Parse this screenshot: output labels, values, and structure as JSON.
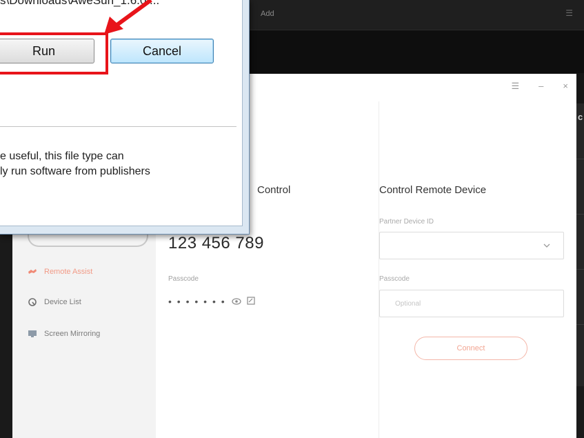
{
  "background_window": {
    "title": "Add",
    "menu_icon": "hamburger-icon",
    "right_edge_char": "c"
  },
  "app": {
    "titlebar": {
      "menu_glyph": "☰",
      "minimize_glyph": "–",
      "close_glyph": "×"
    },
    "sidebar": {
      "items": [
        {
          "label": "Remote Assist",
          "icon": "remote-assist-icon",
          "active": true,
          "color": "#f29a86"
        },
        {
          "label": "Device List",
          "icon": "device-list-icon",
          "active": false
        },
        {
          "label": "Screen Mirroring",
          "icon": "screen-mirroring-icon",
          "active": false
        }
      ]
    },
    "allow_panel": {
      "title": "Control",
      "device_id": "123 456 789",
      "passcode_label": "Passcode",
      "passcode_dots": "• • • • • • •"
    },
    "control_panel": {
      "title": "Control Remote Device",
      "partner_label": "Partner Device ID",
      "passcode_label": "Passcode",
      "passcode_placeholder": "Optional",
      "connect_label": "Connect",
      "accent": "#f2a592"
    }
  },
  "dialog": {
    "path_text": "s\\Downloads\\AweSun_1.6.0....",
    "run_label": "Run",
    "cancel_label": "Cancel",
    "warning_line1": "e useful, this file type can",
    "warning_line2": "ly run software from publishers",
    "highlight_color": "#e8141a"
  }
}
